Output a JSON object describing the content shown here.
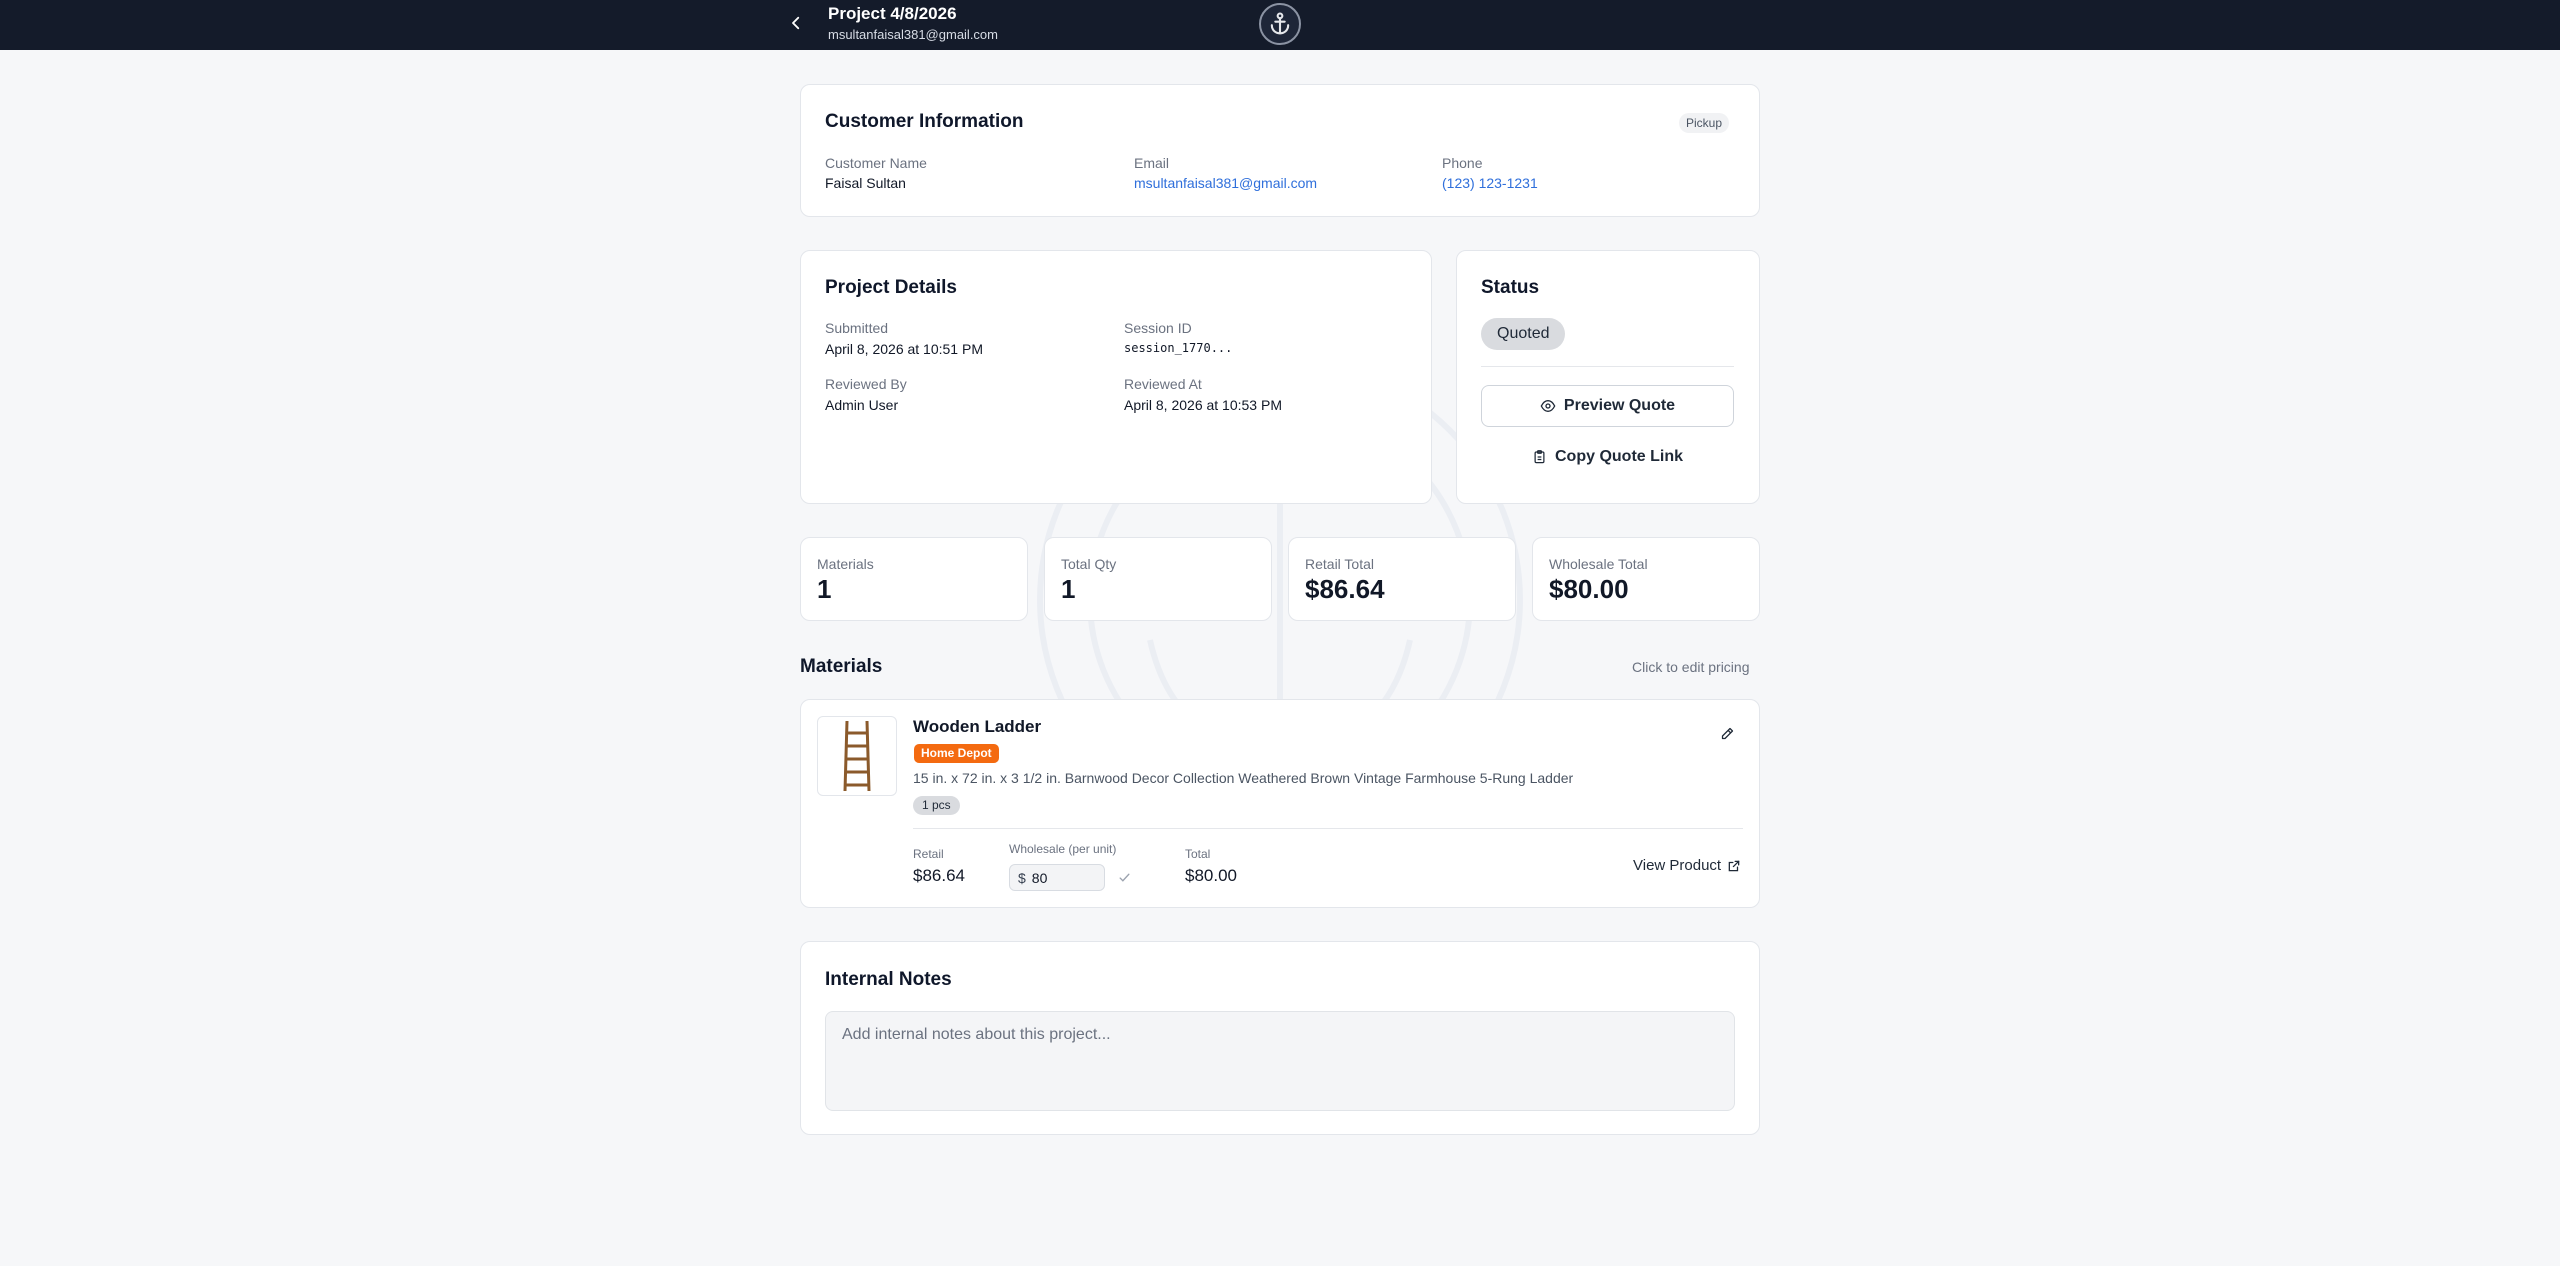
{
  "header": {
    "title": "Project 4/8/2026",
    "subtitle": "msultanfaisal381@gmail.com"
  },
  "customer": {
    "title": "Customer Information",
    "type_badge": "Pickup",
    "name_label": "Customer Name",
    "name": "Faisal Sultan",
    "email_label": "Email",
    "email": "msultanfaisal381@gmail.com",
    "phone_label": "Phone",
    "phone": "(123) 123-1231"
  },
  "project": {
    "title": "Project Details",
    "submitted_label": "Submitted",
    "submitted": "April 8, 2026 at 10:51 PM",
    "session_label": "Session ID",
    "session": "session_1770...",
    "reviewed_by_label": "Reviewed By",
    "reviewed_by": "Admin User",
    "reviewed_at_label": "Reviewed At",
    "reviewed_at": "April 8, 2026 at 10:53 PM"
  },
  "status": {
    "title": "Status",
    "badge": "Quoted",
    "preview_label": "Preview Quote",
    "copy_label": "Copy Quote Link"
  },
  "stats": [
    {
      "label": "Materials",
      "value": "1"
    },
    {
      "label": "Total Qty",
      "value": "1"
    },
    {
      "label": "Retail Total",
      "value": "$86.64"
    },
    {
      "label": "Wholesale Total",
      "value": "$80.00"
    }
  ],
  "materials": {
    "title": "Materials",
    "hint": "Click to edit pricing",
    "items": [
      {
        "name": "Wooden Ladder",
        "store": "Home Depot",
        "description": "15 in. x 72 in. x 3 1/2 in. Barnwood Decor Collection Weathered Brown Vintage Farmhouse 5-Rung Ladder",
        "qty": "1 pcs",
        "retail_label": "Retail",
        "retail": "$86.64",
        "wholesale_label": "Wholesale (per unit)",
        "currency": "$",
        "wholesale_value": "80",
        "total_label": "Total",
        "total": "$80.00",
        "view_label": "View Product"
      }
    ]
  },
  "notes": {
    "title": "Internal Notes",
    "placeholder": "Add internal notes about this project..."
  },
  "colors": {
    "header_bg": "#141b2a",
    "accent_blue": "#2f6fdb",
    "store_orange": "#f46a10"
  }
}
